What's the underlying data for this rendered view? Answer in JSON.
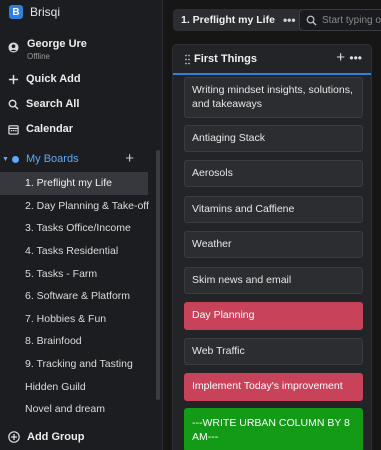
{
  "app": {
    "name": "Brisqi"
  },
  "user": {
    "name": "George Ure",
    "status": "Offline"
  },
  "nav": {
    "quick_add": "Quick Add",
    "search_all": "Search All",
    "calendar": "Calendar"
  },
  "boards": {
    "header": "My Boards",
    "items": [
      "1. Preflight my Life",
      "2. Day Planning & Take-off",
      "3. Tasks Office/Income",
      "4. Tasks Residential",
      "5. Tasks - Farm",
      "6. Software & Platform",
      "7. Hobbies & Fun",
      "8. Brainfood",
      "9. Tracking and Tasting",
      "Hidden Guild",
      "Novel and dream"
    ],
    "active_index": 0
  },
  "add_group": "Add Group",
  "topbar": {
    "tab_label": "1. Preflight my Life",
    "tab_more": "•••",
    "search_placeholder": "Start typing or"
  },
  "column": {
    "title": "First Things",
    "add": "+",
    "more": "•••",
    "cards": [
      {
        "text": "Writing mindset insights, solutions, and takeaways",
        "color": "default"
      },
      {
        "text": "Antiaging Stack",
        "color": "default"
      },
      {
        "text": "Aerosols",
        "color": "default"
      },
      {
        "text": "Vitamins and Caffiene",
        "color": "default"
      },
      {
        "text": "Weather",
        "color": "default"
      },
      {
        "text": "Skim news and email",
        "color": "default"
      },
      {
        "text": "Day Planning",
        "color": "red"
      },
      {
        "text": "Web Traffic",
        "color": "default"
      },
      {
        "text": "Implement Today's improvement",
        "color": "red"
      },
      {
        "text": "---WRITE URBAN COLUMN BY 8 AM---",
        "color": "green"
      }
    ]
  },
  "colors": {
    "accent": "#5fa8f5",
    "red_card": "#c8435a",
    "green_card": "#139a17"
  }
}
